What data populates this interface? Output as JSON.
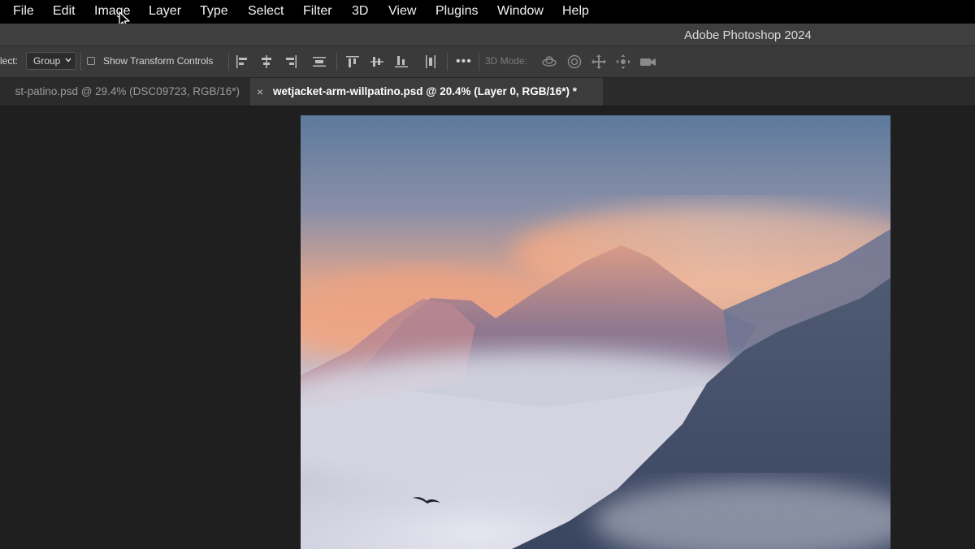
{
  "menubar": {
    "items": [
      "File",
      "Edit",
      "Image",
      "Layer",
      "Type",
      "Select",
      "Filter",
      "3D",
      "View",
      "Plugins",
      "Window",
      "Help"
    ]
  },
  "titlebar": {
    "title": "Adobe Photoshop 2024"
  },
  "options": {
    "select_label": "lect:",
    "select_value": "Group",
    "transform_label": "Show Transform Controls",
    "transform_checked": false,
    "mode_label": "3D Mode:",
    "align_icons": [
      "align-left-edges-icon",
      "align-horizontal-centers-icon",
      "align-right-edges-icon",
      "distribute-horizontal-icon",
      "align-top-edges-icon",
      "align-vertical-centers-icon",
      "align-bottom-edges-icon",
      "distribute-vertical-icon"
    ],
    "more_icon": "more-options-icon",
    "mode_icons": [
      "orbit-3d-icon",
      "roll-3d-icon",
      "pan-3d-icon",
      "slide-3d-icon",
      "camera-3d-icon"
    ]
  },
  "tabs": [
    {
      "label": "st-patino.psd @ 29.4% (DSC09723, RGB/16*)",
      "active": false
    },
    {
      "label": "wetjacket-arm-willpatino.psd @ 20.4% (Layer 0, RGB/16*) *",
      "active": true,
      "close": "×"
    }
  ],
  "colors": {
    "menubar": "#000000",
    "titlebar": "#3f3f3f",
    "optionsbar": "#3a3a3a",
    "workspace": "#1f1f1f",
    "active_tab": "#3c3c3c"
  }
}
